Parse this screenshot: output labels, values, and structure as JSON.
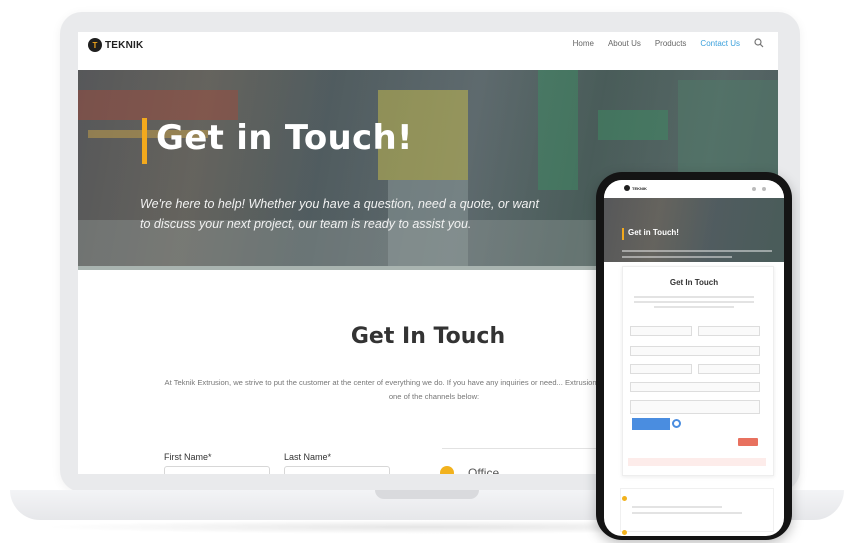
{
  "nav": {
    "logo_mark": "T",
    "logo_text": "TEKNIK",
    "links": [
      "Home",
      "About Us",
      "Products",
      "Contact Us"
    ],
    "active_link": "Contact Us"
  },
  "hero": {
    "title": "Get in Touch!",
    "subtitle": "We're here to help! Whether you have a question, need a quote, or want to discuss your next project, our team is ready to assist you."
  },
  "section": {
    "title": "Get In Touch",
    "intro": "At Teknik Extrusion, we strive to put the customer at the center of everything we do. If you have any inquiries or need... Extrusion, please reach out to us through one of the channels below:"
  },
  "form": {
    "first_name_label": "First Name*",
    "last_name_label": "Last Name*"
  },
  "office": {
    "label": "Office"
  },
  "phone": {
    "hero_title": "Get in Touch!",
    "section_title": "Get In Touch"
  },
  "colors": {
    "accent": "#f2a91d",
    "link_active": "#3aa0dc",
    "submit": "#e8715f"
  }
}
